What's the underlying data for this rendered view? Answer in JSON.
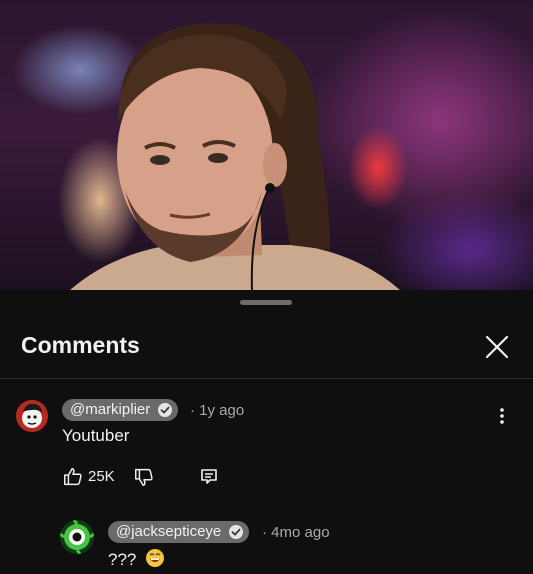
{
  "sheet": {
    "title": "Comments"
  },
  "comments": [
    {
      "handle": "@markiplier",
      "time": "· 1y ago",
      "text": "Youtuber",
      "likes": "25K"
    }
  ],
  "reply": {
    "handle": "@jacksepticeye",
    "time": "· 4mo ago",
    "text": "???"
  },
  "icons": {
    "close": "close-icon",
    "like": "thumbs-up-icon",
    "dislike": "thumbs-down-icon",
    "reply": "reply-comment-icon",
    "more": "more-vertical-icon",
    "verified": "verified-check-icon",
    "emoji": "grinning-emoji-icon"
  }
}
